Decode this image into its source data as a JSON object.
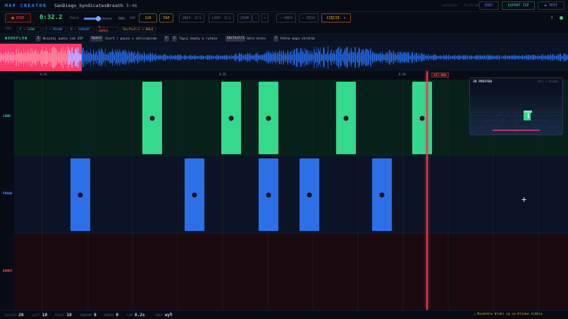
{
  "app": {
    "title": "MAP CREATOR",
    "song": "SanDiego_SyndicatesBreath",
    "duration": "3:46",
    "saved": "autosave · 23:45:06"
  },
  "topbar": {
    "exec_label": "EXEC",
    "export_label": "EXPORT ZIP",
    "test_label": "▶ TEST"
  },
  "controls": {
    "stop_label": "■ STOP",
    "time": "0:32.2",
    "track_label": "TRACK",
    "volume_pct": "50%",
    "volume_level": 0.5,
    "bpm_label": "BPM",
    "bpm_value": "120",
    "tap_label": "TAP",
    "snap_label": "SNAP: 0/1",
    "loop_label": "LOOP: 0/1",
    "zoom_label": "ZOOM",
    "zoom_minus": "−",
    "zoom_plus": "+",
    "undo_label": "↶ UNDO",
    "redo_label": "↷ REDO",
    "cut_label": "CIĘCIE: ▾",
    "help_label": "?"
  },
  "keys": {
    "tap": "TAP:",
    "items": [
      {
        "label": "F → LEWO",
        "color": "#34d98c"
      },
      {
        "label": "J → PRAWO",
        "color": "#4a8cff"
      },
      {
        "label": "B → RANDOM",
        "color": "#4a8cff"
      },
      {
        "label": "K → BOMBA",
        "color": "#ff4a4a"
      },
      {
        "label": "Shift+F/J → HOLD",
        "color": "#f0b429"
      }
    ]
  },
  "workflow": {
    "label": "WORKFLOW",
    "steps": [
      {
        "key": "1",
        "text": "Wczytaj audio lub ZIP"
      },
      {
        "key": "Space",
        "text": "Start / pauza z odliczaniem"
      },
      {
        "key": "F",
        "key2": "J",
        "text": "Tapuj beaty w rytmie"
      },
      {
        "key": "Shift+F/J",
        "text": "Hold notes"
      },
      {
        "key": "?",
        "text": "Pełna mapa skrótów"
      }
    ]
  },
  "ruler": {
    "ticks": [
      "0:26",
      "0:28",
      "0:30",
      "0:32"
    ],
    "hit_label": "HIT NOW"
  },
  "lanes": {
    "left": {
      "label": "LEWO",
      "color": "#34d98c"
    },
    "right": {
      "label": "PRAWO",
      "color": "#4a8cff"
    },
    "bomb": {
      "label": "BOMBY",
      "color": "#ff4a4a"
    }
  },
  "preview": {
    "title": "3D PREVIEW",
    "subtitle": "NEXT 4 SECONDS"
  },
  "status": {
    "blocks_label": "BLOCKS",
    "blocks": "20",
    "left_label": "LEFT",
    "left": "10",
    "right_label": "RIGHT",
    "right": "10",
    "random_label": "RANDOM",
    "random": "0",
    "bombs_label": "BOMBS",
    "bombs": "0",
    "len_label": "LEN",
    "len": "6.2s",
    "snap_label": "SNAP",
    "snap": "wył",
    "warning": "⚠ Niektóre bloki są za blisko siebie"
  },
  "colors": {
    "accent": "#2e8cff",
    "left": "#34d98c",
    "right": "#2d6fe6",
    "bomb": "#ff4a4a",
    "playhead": "#e83a4a",
    "bpm": "#f0b429"
  }
}
